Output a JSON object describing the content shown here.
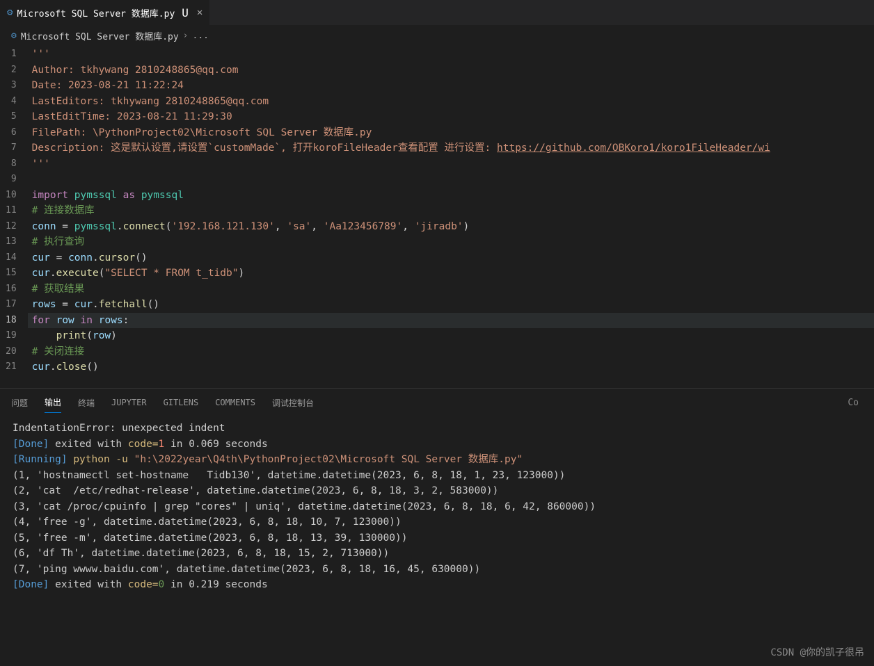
{
  "tab": {
    "title": "Microsoft SQL Server 数据库.py",
    "modified_marker": "U",
    "close": "✕"
  },
  "breadcrumb": {
    "file": "Microsoft SQL Server 数据库.py",
    "sep": "›",
    "more": "..."
  },
  "code_lines": [
    {
      "n": 1,
      "segs": [
        {
          "c": "tok-str",
          "t": "'''"
        }
      ]
    },
    {
      "n": 2,
      "segs": [
        {
          "c": "tok-str",
          "t": "Author: tkhywang 2810248865@qq.com"
        }
      ]
    },
    {
      "n": 3,
      "segs": [
        {
          "c": "tok-str",
          "t": "Date: 2023-08-21 11:22:24"
        }
      ]
    },
    {
      "n": 4,
      "segs": [
        {
          "c": "tok-str",
          "t": "LastEditors: tkhywang 2810248865@qq.com"
        }
      ]
    },
    {
      "n": 5,
      "segs": [
        {
          "c": "tok-str",
          "t": "LastEditTime: 2023-08-21 11:29:30"
        }
      ]
    },
    {
      "n": 6,
      "segs": [
        {
          "c": "tok-str",
          "t": "FilePath: \\PythonProject02\\Microsoft SQL Server 数据库.py"
        }
      ]
    },
    {
      "n": 7,
      "segs": [
        {
          "c": "tok-str",
          "t": "Description: 这是默认设置,请设置`customMade`, 打开koroFileHeader查看配置 进行设置: "
        },
        {
          "c": "tok-link",
          "t": "https://github.com/OBKoro1/koro1FileHeader/wi"
        }
      ]
    },
    {
      "n": 8,
      "segs": [
        {
          "c": "tok-str",
          "t": "'''"
        }
      ]
    },
    {
      "n": 9,
      "segs": [
        {
          "c": "",
          "t": ""
        }
      ]
    },
    {
      "n": 10,
      "segs": [
        {
          "c": "tok-kw",
          "t": "import"
        },
        {
          "c": "tok-op",
          "t": " "
        },
        {
          "c": "tok-cls",
          "t": "pymssql"
        },
        {
          "c": "tok-op",
          "t": " "
        },
        {
          "c": "tok-kw",
          "t": "as"
        },
        {
          "c": "tok-op",
          "t": " "
        },
        {
          "c": "tok-cls",
          "t": "pymssql"
        }
      ]
    },
    {
      "n": 11,
      "segs": [
        {
          "c": "tok-cmt",
          "t": "# 连接数据库"
        }
      ]
    },
    {
      "n": 12,
      "segs": [
        {
          "c": "tok-var",
          "t": "conn"
        },
        {
          "c": "tok-op",
          "t": " = "
        },
        {
          "c": "tok-cls",
          "t": "pymssql"
        },
        {
          "c": "tok-op",
          "t": "."
        },
        {
          "c": "tok-fn",
          "t": "connect"
        },
        {
          "c": "tok-op",
          "t": "("
        },
        {
          "c": "tok-str",
          "t": "'192.168.121.130'"
        },
        {
          "c": "tok-op",
          "t": ", "
        },
        {
          "c": "tok-str",
          "t": "'sa'"
        },
        {
          "c": "tok-op",
          "t": ", "
        },
        {
          "c": "tok-str",
          "t": "'Aa123456789'"
        },
        {
          "c": "tok-op",
          "t": ", "
        },
        {
          "c": "tok-str",
          "t": "'jiradb'"
        },
        {
          "c": "tok-op",
          "t": ")"
        }
      ]
    },
    {
      "n": 13,
      "segs": [
        {
          "c": "tok-cmt",
          "t": "# 执行查询"
        }
      ]
    },
    {
      "n": 14,
      "segs": [
        {
          "c": "tok-var",
          "t": "cur"
        },
        {
          "c": "tok-op",
          "t": " = "
        },
        {
          "c": "tok-var",
          "t": "conn"
        },
        {
          "c": "tok-op",
          "t": "."
        },
        {
          "c": "tok-fn",
          "t": "cursor"
        },
        {
          "c": "tok-op",
          "t": "()"
        }
      ]
    },
    {
      "n": 15,
      "segs": [
        {
          "c": "tok-var",
          "t": "cur"
        },
        {
          "c": "tok-op",
          "t": "."
        },
        {
          "c": "tok-fn",
          "t": "execute"
        },
        {
          "c": "tok-op",
          "t": "("
        },
        {
          "c": "tok-str",
          "t": "\"SELECT * FROM t_tidb\""
        },
        {
          "c": "tok-op",
          "t": ")"
        }
      ]
    },
    {
      "n": 16,
      "segs": [
        {
          "c": "tok-cmt",
          "t": "# 获取结果"
        }
      ]
    },
    {
      "n": 17,
      "segs": [
        {
          "c": "tok-var",
          "t": "rows"
        },
        {
          "c": "tok-op",
          "t": " = "
        },
        {
          "c": "tok-var",
          "t": "cur"
        },
        {
          "c": "tok-op",
          "t": "."
        },
        {
          "c": "tok-fn",
          "t": "fetchall"
        },
        {
          "c": "tok-op",
          "t": "()"
        }
      ]
    },
    {
      "n": 18,
      "hl": true,
      "segs": [
        {
          "c": "tok-kw",
          "t": "for"
        },
        {
          "c": "tok-op",
          "t": " "
        },
        {
          "c": "tok-var",
          "t": "row"
        },
        {
          "c": "tok-op",
          "t": " "
        },
        {
          "c": "tok-kw",
          "t": "in"
        },
        {
          "c": "tok-op",
          "t": " "
        },
        {
          "c": "tok-var",
          "t": "rows"
        },
        {
          "c": "tok-op",
          "t": ":"
        }
      ]
    },
    {
      "n": 19,
      "segs": [
        {
          "c": "tok-op",
          "t": "    "
        },
        {
          "c": "tok-fn",
          "t": "print"
        },
        {
          "c": "tok-op",
          "t": "("
        },
        {
          "c": "tok-var",
          "t": "row"
        },
        {
          "c": "tok-op",
          "t": ")"
        }
      ]
    },
    {
      "n": 20,
      "segs": [
        {
          "c": "tok-cmt",
          "t": "# 关闭连接"
        }
      ]
    },
    {
      "n": 21,
      "segs": [
        {
          "c": "tok-var",
          "t": "cur"
        },
        {
          "c": "tok-op",
          "t": "."
        },
        {
          "c": "tok-fn",
          "t": "close"
        },
        {
          "c": "tok-op",
          "t": "()"
        }
      ]
    }
  ],
  "panel_tabs": {
    "problems": "问题",
    "output": "输出",
    "terminal": "终端",
    "jupyter": "JUPYTER",
    "gitlens": "GITLENS",
    "comments": "COMMENTS",
    "debug": "调试控制台",
    "right": "Co"
  },
  "output_lines": [
    [
      {
        "c": "",
        "t": "IndentationError: unexpected indent"
      }
    ],
    [
      {
        "c": "",
        "t": ""
      }
    ],
    [
      {
        "c": "o-brkt",
        "t": "[Done]"
      },
      {
        "c": "",
        "t": " exited with "
      },
      {
        "c": "o-cmd",
        "t": "code="
      },
      {
        "c": "o-code1",
        "t": "1"
      },
      {
        "c": "",
        "t": " in 0.069 seconds"
      }
    ],
    [
      {
        "c": "",
        "t": ""
      }
    ],
    [
      {
        "c": "o-brkt",
        "t": "[Running]"
      },
      {
        "c": "",
        "t": " "
      },
      {
        "c": "o-cmd",
        "t": "python -u "
      },
      {
        "c": "o-path",
        "t": "\"h:\\2022year\\Q4th\\PythonProject02\\Microsoft SQL Server 数据库.py\""
      }
    ],
    [
      {
        "c": "",
        "t": "(1, 'hostnamectl set-hostname   Tidb130', datetime.datetime(2023, 6, 8, 18, 1, 23, 123000))"
      }
    ],
    [
      {
        "c": "",
        "t": "(2, 'cat  /etc/redhat-release', datetime.datetime(2023, 6, 8, 18, 3, 2, 583000))"
      }
    ],
    [
      {
        "c": "",
        "t": "(3, 'cat /proc/cpuinfo | grep \"cores\" | uniq', datetime.datetime(2023, 6, 8, 18, 6, 42, 860000))"
      }
    ],
    [
      {
        "c": "",
        "t": "(4, 'free -g', datetime.datetime(2023, 6, 8, 18, 10, 7, 123000))"
      }
    ],
    [
      {
        "c": "",
        "t": "(5, 'free -m', datetime.datetime(2023, 6, 8, 18, 13, 39, 130000))"
      }
    ],
    [
      {
        "c": "",
        "t": "(6, 'df Th', datetime.datetime(2023, 6, 8, 18, 15, 2, 713000))"
      }
    ],
    [
      {
        "c": "",
        "t": "(7, 'ping wwww.baidu.com', datetime.datetime(2023, 6, 8, 18, 16, 45, 630000))"
      }
    ],
    [
      {
        "c": "",
        "t": ""
      }
    ],
    [
      {
        "c": "o-brkt",
        "t": "[Done]"
      },
      {
        "c": "",
        "t": " exited with "
      },
      {
        "c": "o-cmd",
        "t": "code="
      },
      {
        "c": "o-code0",
        "t": "0"
      },
      {
        "c": "",
        "t": " in 0.219 seconds"
      }
    ]
  ],
  "watermark": "CSDN @你的凯子很吊"
}
